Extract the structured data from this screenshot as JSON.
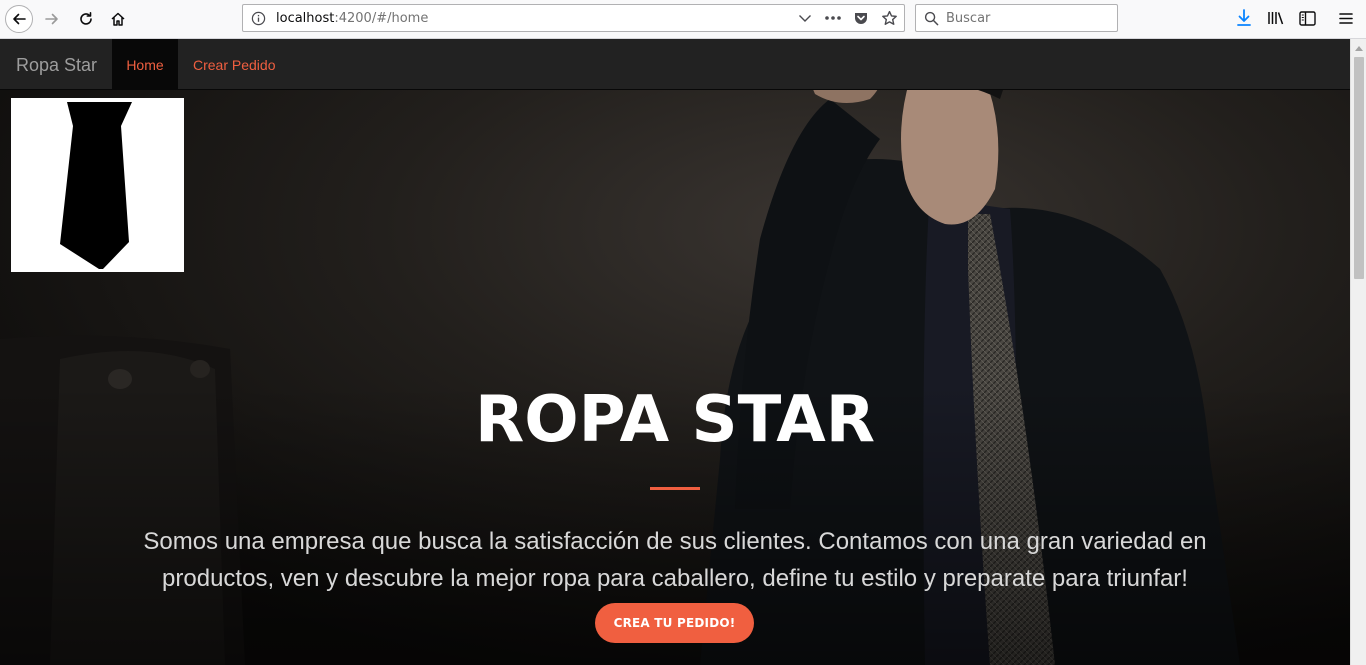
{
  "browser": {
    "url_host": "localhost",
    "url_rest": ":4200/#/home",
    "search_placeholder": "Buscar"
  },
  "site": {
    "brand": "Ropa Star",
    "nav": [
      {
        "label": "Home"
      },
      {
        "label": "Crear Pedido"
      }
    ]
  },
  "hero": {
    "title": "ROPA STAR",
    "text": "Somos una empresa que busca la satisfacción de sus clientes. Contamos con una gran variedad en productos, ven y descubre la mejor ropa para caballero, define tu estilo y preparate para triunfar!",
    "cta_label": "CREA TU PEDIDO!"
  },
  "colors": {
    "accent": "#f05f40",
    "navbar": "#222222",
    "brand_text": "#9d9d9d"
  },
  "icons": [
    "back-icon",
    "forward-icon",
    "reload-icon",
    "home-icon",
    "info-icon",
    "dropdown-icon",
    "more-icon",
    "pocket-icon",
    "bookmark-star-icon",
    "search-icon",
    "download-icon",
    "library-icon",
    "sidebar-icon",
    "menu-icon",
    "tie-logo"
  ]
}
